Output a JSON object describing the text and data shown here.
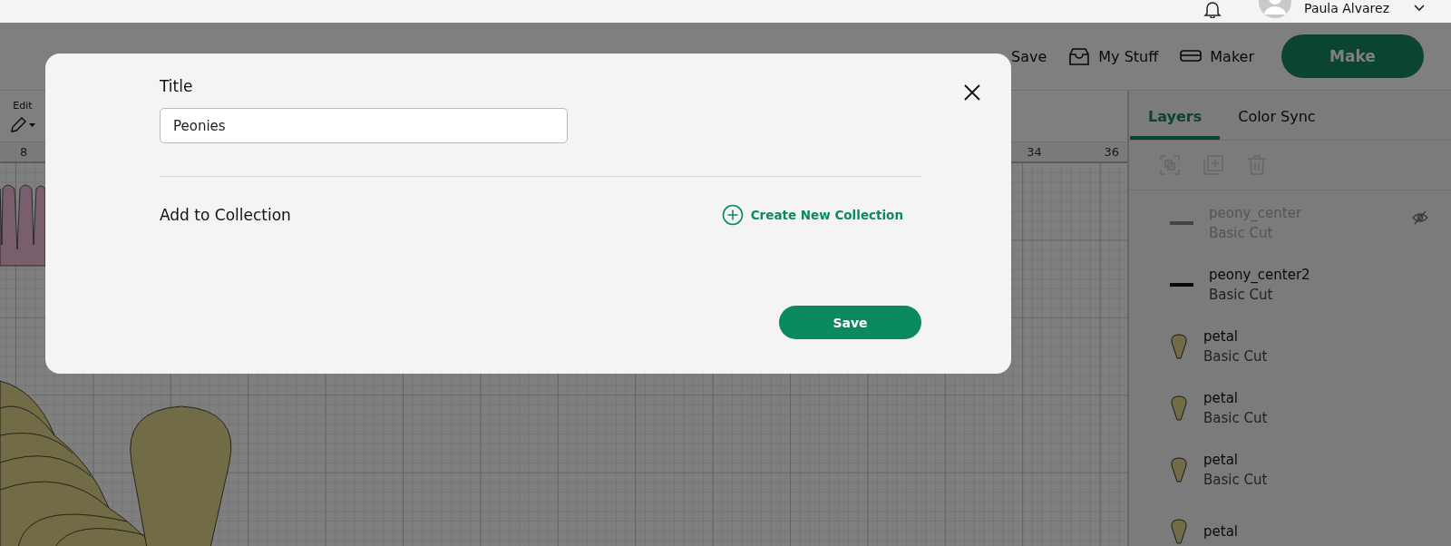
{
  "top_bar": {
    "user_name": "Paula Alvarez"
  },
  "header": {
    "actions": [
      {
        "label": "Save",
        "kind": "plain"
      },
      {
        "label": "My Stuff",
        "kind": "tray"
      },
      {
        "label": "Maker",
        "kind": "machine"
      }
    ],
    "make_button": "Make"
  },
  "toolbar": {
    "edit_label": "Edit"
  },
  "canvas": {
    "ruler": [
      "8",
      "34",
      "36"
    ]
  },
  "layers_panel": {
    "tabs": [
      {
        "label": "Layers",
        "selected": true
      },
      {
        "label": "Color Sync",
        "selected": false
      }
    ],
    "layers": [
      {
        "name": "peony_center",
        "type": "Basic Cut",
        "kind": "line",
        "hidden": true
      },
      {
        "name": "peony_center2",
        "type": "Basic Cut",
        "kind": "dark-line",
        "hidden": false
      },
      {
        "name": "petal",
        "type": "Basic Cut",
        "kind": "petal",
        "hidden": false
      },
      {
        "name": "petal",
        "type": "Basic Cut",
        "kind": "petal",
        "hidden": false
      },
      {
        "name": "petal",
        "type": "Basic Cut",
        "kind": "petal",
        "hidden": false
      },
      {
        "name": "petal",
        "kind": "petal",
        "hidden": false
      }
    ]
  },
  "dialog": {
    "title_label": "Title",
    "title_value": "Peonies",
    "collection_label": "Add to Collection",
    "create_collection": "Create New Collection",
    "save_button": "Save"
  }
}
